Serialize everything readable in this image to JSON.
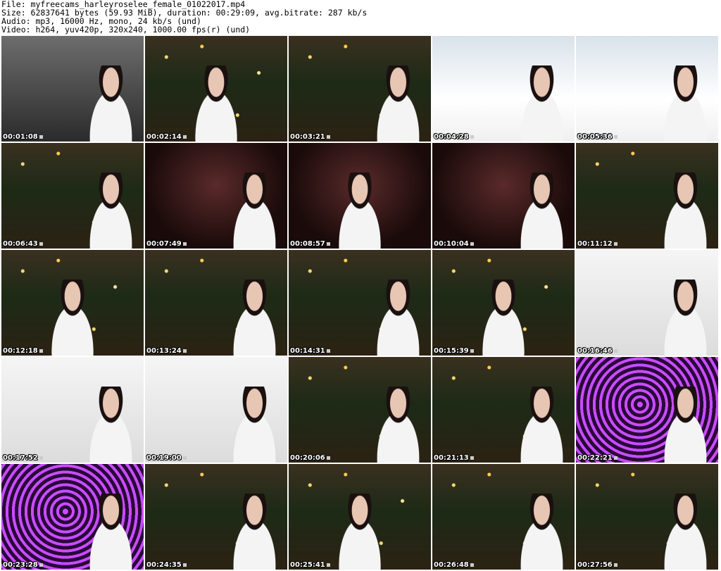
{
  "header": {
    "file": "File: myfreecams_harleyroselee_female_01022017.mp4",
    "size": "Size: 62837641 bytes (59.93 MiB), duration: 00:29:09, avg.bitrate: 287 kb/s",
    "audio": "Audio: mp3, 16000 Hz, mono, 24 kb/s (und)",
    "video": "Video: h264, yuv420p, 320x240, 1000.00 fps(r) (und)"
  },
  "thumbnails": [
    {
      "time": "00:01:08",
      "scene": "bw"
    },
    {
      "time": "00:02:14",
      "scene": "xmas"
    },
    {
      "time": "00:03:21",
      "scene": "xmas"
    },
    {
      "time": "00:04:28",
      "scene": "snow"
    },
    {
      "time": "00:05:36",
      "scene": "snow"
    },
    {
      "time": "00:06:43",
      "scene": "xmas"
    },
    {
      "time": "00:07:49",
      "scene": "stage"
    },
    {
      "time": "00:08:57",
      "scene": "stage"
    },
    {
      "time": "00:10:04",
      "scene": "stage"
    },
    {
      "time": "00:11:12",
      "scene": "xmas"
    },
    {
      "time": "00:12:18",
      "scene": "xmas"
    },
    {
      "time": "00:13:24",
      "scene": "xmas"
    },
    {
      "time": "00:14:31",
      "scene": "xmas"
    },
    {
      "time": "00:15:39",
      "scene": "xmas"
    },
    {
      "time": "00:16:46",
      "scene": "studio"
    },
    {
      "time": "00:17:52",
      "scene": "studio"
    },
    {
      "time": "00:19:00",
      "scene": "studio"
    },
    {
      "time": "00:20:06",
      "scene": "xmas"
    },
    {
      "time": "00:21:13",
      "scene": "xmas"
    },
    {
      "time": "00:22:21",
      "scene": "purple"
    },
    {
      "time": "00:23:28",
      "scene": "purple"
    },
    {
      "time": "00:24:35",
      "scene": "xmas"
    },
    {
      "time": "00:25:41",
      "scene": "xmas"
    },
    {
      "time": "00:26:48",
      "scene": "xmas"
    },
    {
      "time": "00:27:56",
      "scene": "xmas"
    }
  ]
}
